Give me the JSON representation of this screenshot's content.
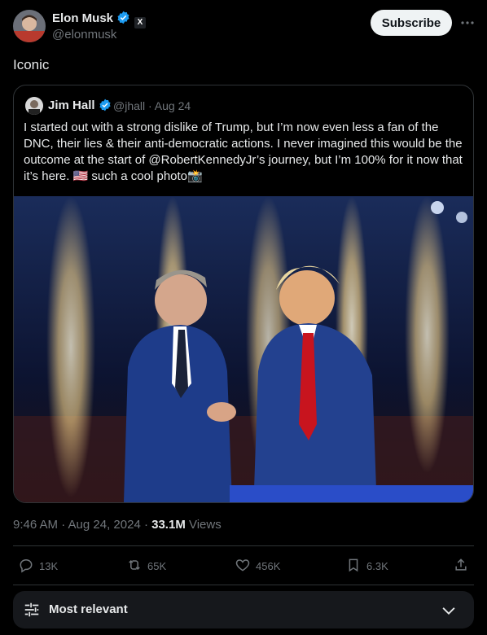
{
  "author": {
    "name": "Elon Musk",
    "handle": "@elonmusk",
    "badge_letter": "X"
  },
  "header": {
    "subscribe_label": "Subscribe"
  },
  "tweet": {
    "text": "Iconic"
  },
  "quote": {
    "name": "Jim Hall",
    "meta": "@jhall · Aug 24",
    "text": "I started out with a strong dislike of Trump, but I’m now even less a fan of the DNC, their lies & their anti-democratic actions. I never imagined this would be the outcome at the start of @RobertKennedyJr’s journey, but I’m 100% for it now that it’s here. 🇺🇸 such a cool photo📸"
  },
  "meta": {
    "time_date": "9:46 AM · Aug 24, 2024 · ",
    "views_count": "33.1M",
    "views_label": " Views"
  },
  "actions": {
    "replies": "13K",
    "reposts": "65K",
    "likes": "456K",
    "bookmarks": "6.3K"
  },
  "sort": {
    "label": "Most relevant"
  },
  "colors": {
    "background": "#000000",
    "verified_blue": "#1d9bf0",
    "muted_text": "#71767b",
    "divider": "#2f3336"
  }
}
